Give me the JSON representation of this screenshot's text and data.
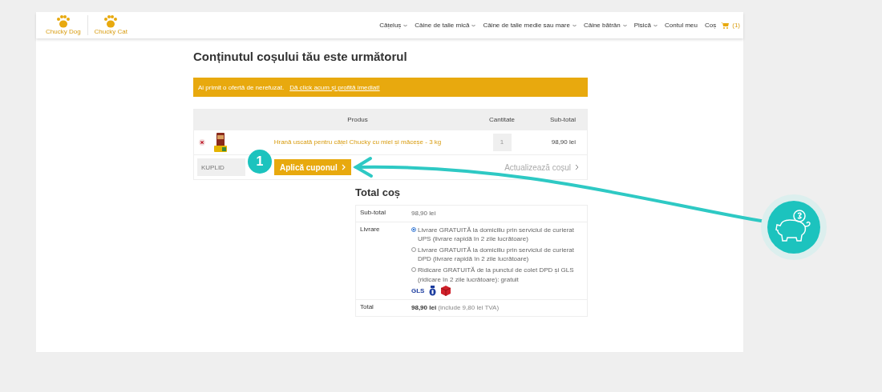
{
  "header": {
    "logos": [
      {
        "label": "Chucky Dog"
      },
      {
        "label": "Chucky Cat"
      }
    ],
    "nav": [
      {
        "label": "Cățeluș",
        "dropdown": true
      },
      {
        "label": "Câine de talie mică",
        "dropdown": true
      },
      {
        "label": "Câine de talie medie sau mare",
        "dropdown": true
      },
      {
        "label": "Câine bătrân",
        "dropdown": true
      },
      {
        "label": "Pisică",
        "dropdown": true
      },
      {
        "label": "Contul meu",
        "dropdown": false
      },
      {
        "label": "Coș",
        "dropdown": false
      }
    ],
    "cart_count": "(1)"
  },
  "page_title": "Conținutul coșului tău este următorul",
  "notice": {
    "text": "Ai primit o ofertă de nerefuzat.",
    "link": "Dă click acum și profită imediat!"
  },
  "cart_table": {
    "columns": [
      "Produs",
      "Cantitate",
      "Sub-total"
    ],
    "rows": [
      {
        "product": "Hrană uscată pentru cățel Chucky cu miel și măceșe - 3 kg",
        "quantity": "1",
        "subtotal": "98,90 lei"
      }
    ],
    "coupon_placeholder": "KUPLID",
    "apply_button": "Aplică cuponul",
    "update_button": "Actualizează coșul"
  },
  "totals": {
    "title": "Total coș",
    "subtotal_label": "Sub-total",
    "subtotal": "98,90 lei",
    "shipping_label": "Livrare",
    "shipping_options": [
      {
        "label": "Livrare GRATUITĂ la domiciliu prin serviciul de curierat UPS (livrare rapidă în 2 zile lucrătoare)",
        "selected": true
      },
      {
        "label": "Livrare GRATUITĂ la domiciliu prin serviciul de curierat DPD (livrare rapidă în 2 zile lucrătoare)",
        "selected": false
      },
      {
        "label": "Ridicare GRATUITĂ de la punctul de colet DPD și GLS (ridicare în 2 zile lucrătoare): gratuit",
        "selected": false
      }
    ],
    "carrier_logo": "GLS",
    "total_label": "Total",
    "total": "98,90 lei",
    "total_note": "(include 9,80 lei TVA)"
  },
  "annotation": {
    "step": "1"
  }
}
